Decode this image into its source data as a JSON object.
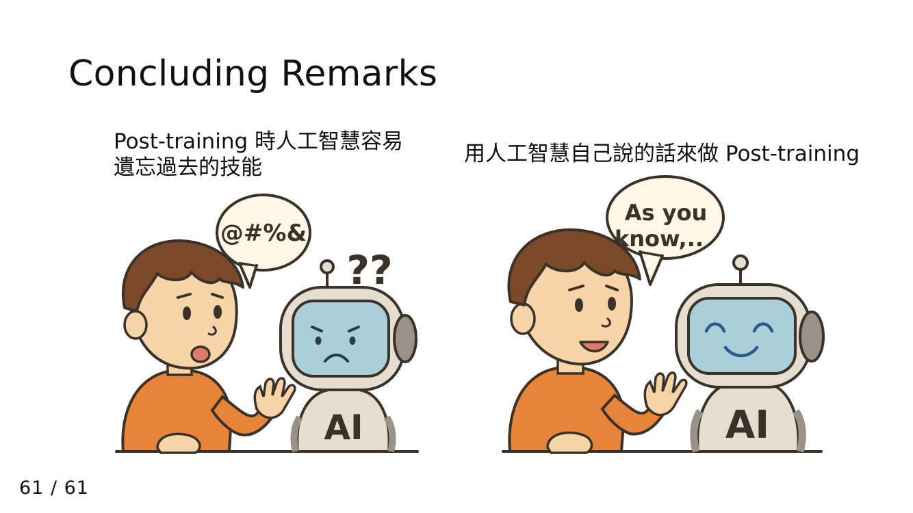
{
  "slide": {
    "title": "Concluding Remarks",
    "page_number": "61 / 61"
  },
  "left_panel": {
    "caption_line1": "Post-training 時人工智慧容易",
    "caption_line2": "遺忘過去的技能",
    "speech_bubble": "@#%&",
    "robot_thought": "??",
    "robot_chest_label": "AI",
    "robot_mood": "sad-confused"
  },
  "right_panel": {
    "caption": "用人工智慧自己說的話來做 Post-training",
    "speech_bubble_line1": "As you",
    "speech_bubble_line2": "know,..",
    "robot_chest_label": "AI",
    "robot_mood": "happy"
  },
  "colors": {
    "shirt": "#e8843a",
    "skin": "#f7d3a8",
    "hair": "#7a4a28",
    "robot_body": "#e4ddd0",
    "robot_screen": "#a9cfd8",
    "outline": "#3a3128"
  }
}
